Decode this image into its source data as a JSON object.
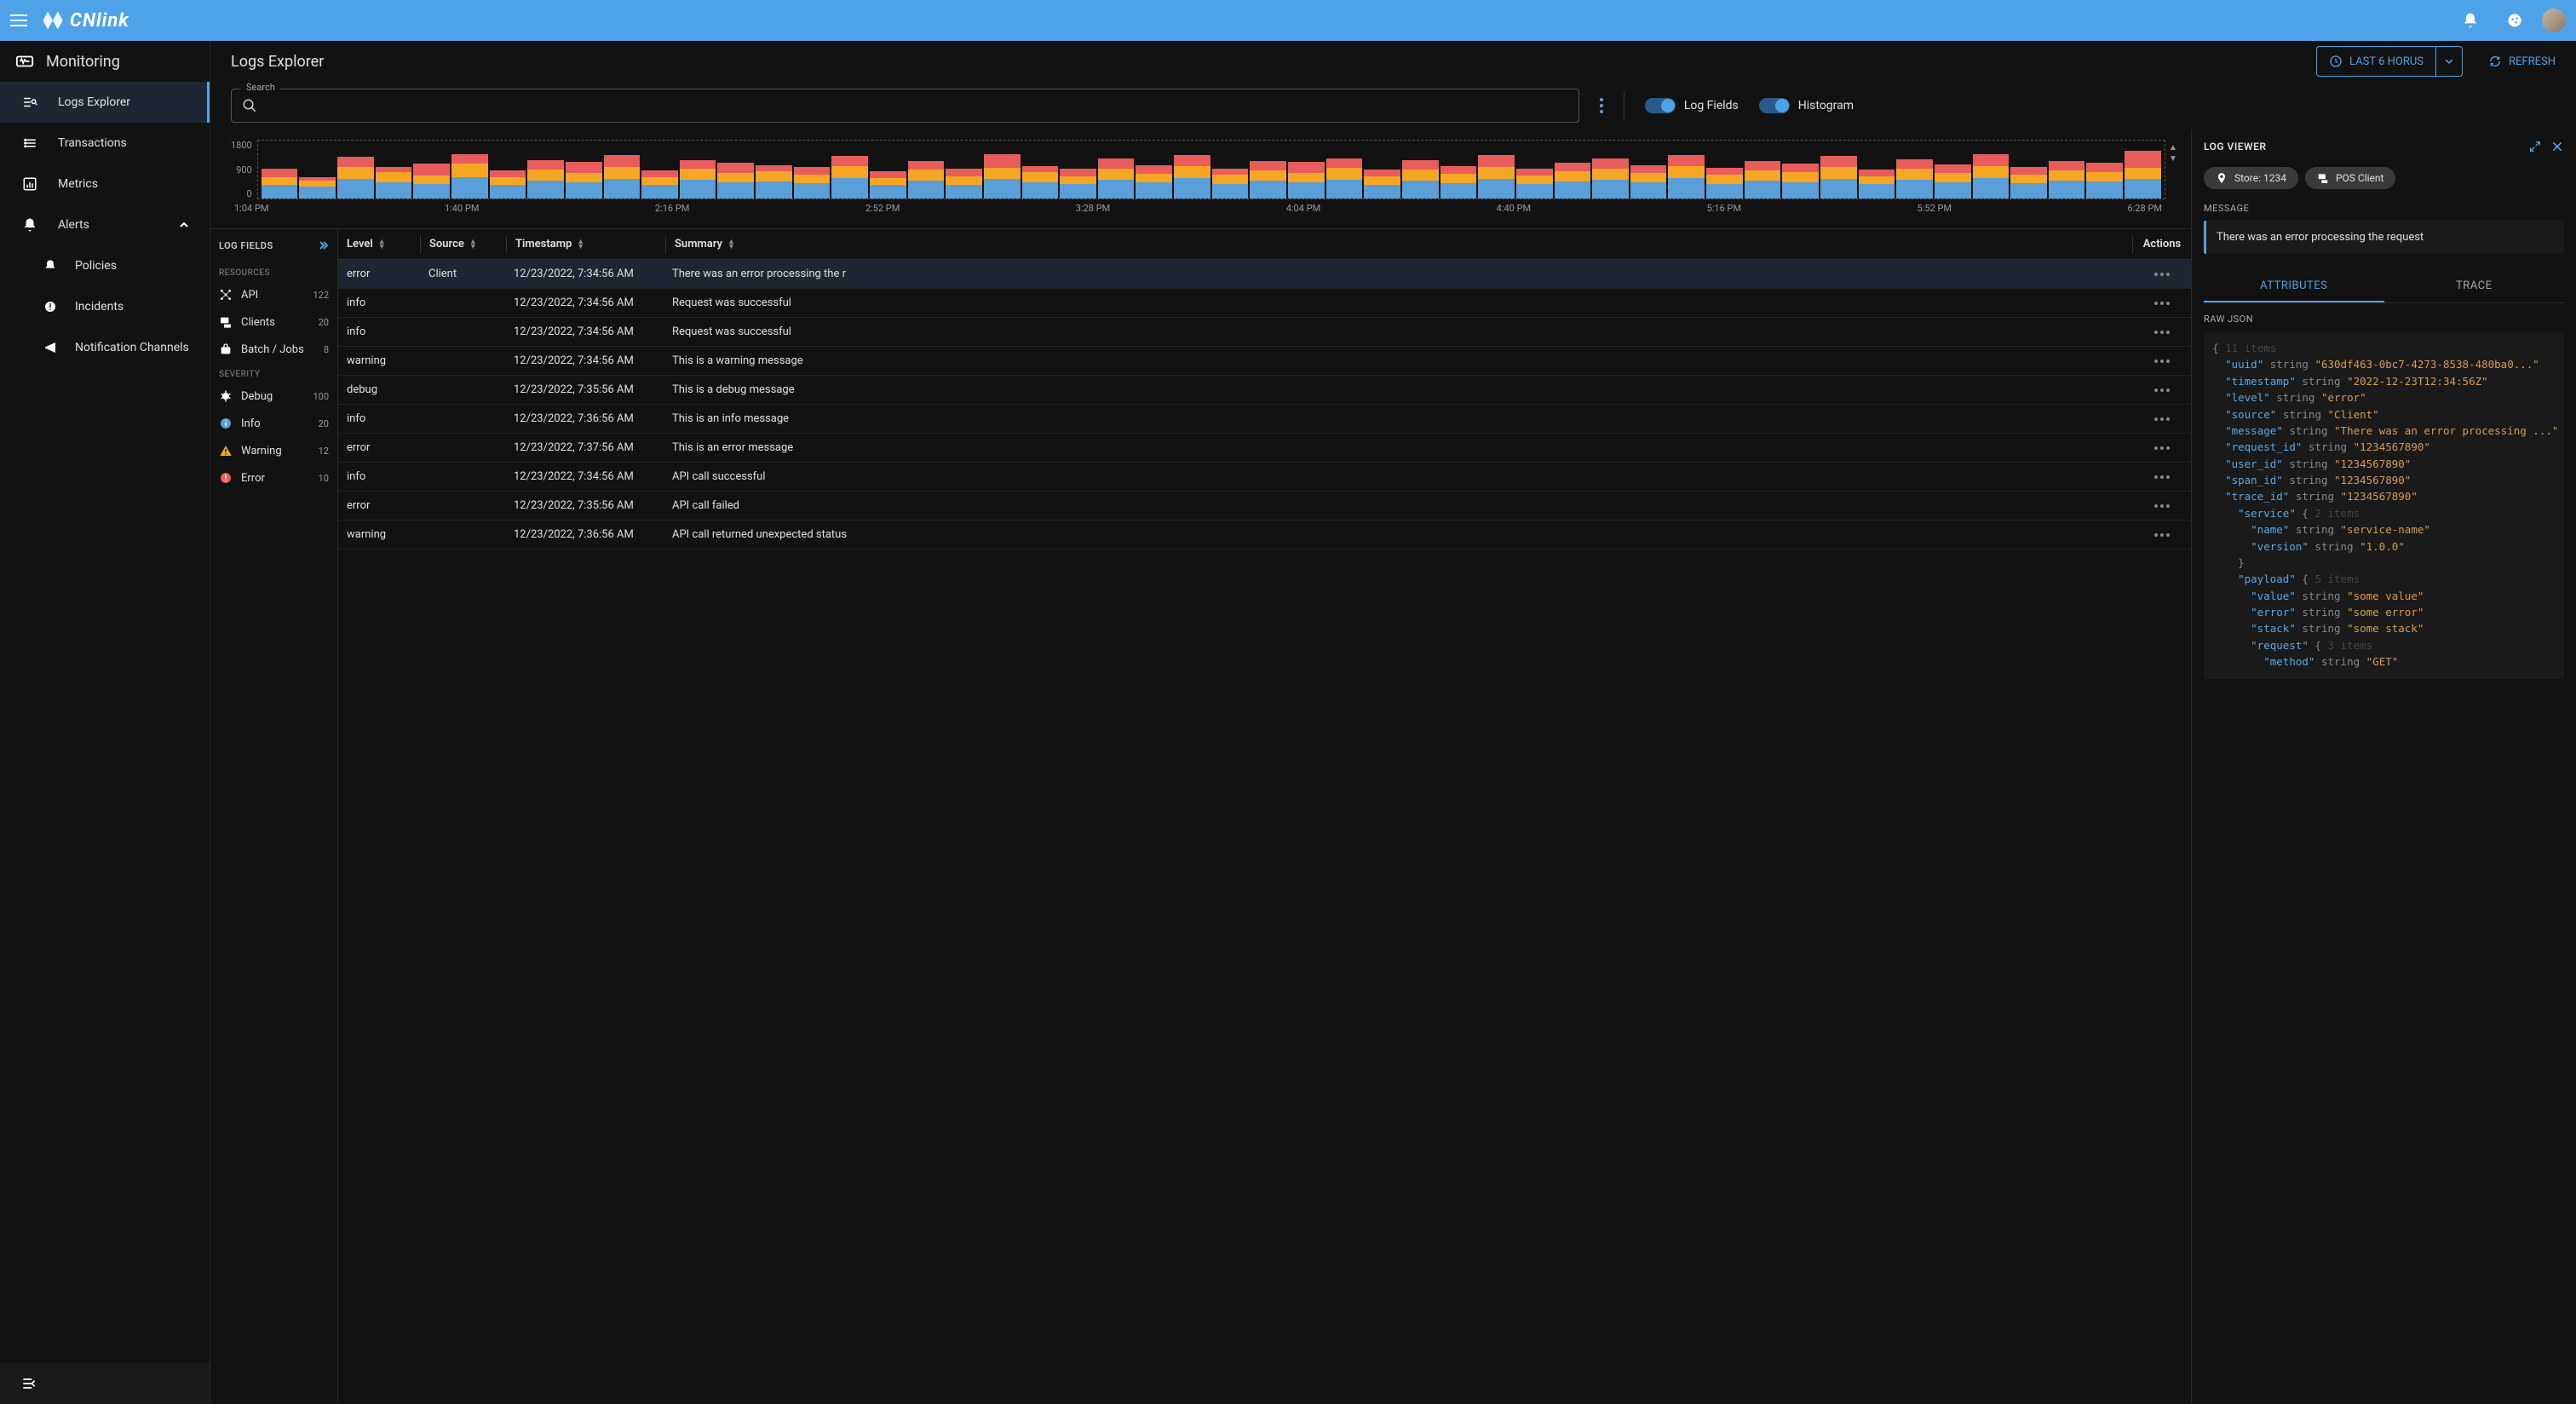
{
  "topbar": {
    "brand": "CNlink"
  },
  "sidebar": {
    "header": "Monitoring",
    "items": [
      {
        "label": "Logs Explorer",
        "active": true
      },
      {
        "label": "Transactions"
      },
      {
        "label": "Metrics"
      },
      {
        "label": "Alerts",
        "expanded": true,
        "children": [
          {
            "label": "Policies"
          },
          {
            "label": "Incidents"
          },
          {
            "label": "Notification Channels"
          }
        ]
      }
    ]
  },
  "header": {
    "title": "Logs Explorer",
    "range_label": "LAST 6 HORUS",
    "refresh_label": "REFRESH"
  },
  "controls": {
    "search_legend": "Search",
    "toggle_fields": "Log Fields",
    "toggle_histogram": "Histogram"
  },
  "chart_data": {
    "type": "bar",
    "ylim": [
      0,
      1800
    ],
    "yticks": [
      0,
      900,
      1800
    ],
    "xticks": [
      "1:04 PM",
      "1:40 PM",
      "2:16 PM",
      "2:52 PM",
      "3:28 PM",
      "4:04 PM",
      "4:40 PM",
      "5:16 PM",
      "5:52 PM",
      "6:28 PM"
    ],
    "series_names": [
      "info",
      "warning",
      "error"
    ],
    "colors": {
      "info": "#5a9fd8",
      "warning": "#f5a623",
      "error": "#e85c5c"
    },
    "bars": [
      {
        "info": 400,
        "warning": 250,
        "error": 250
      },
      {
        "info": 350,
        "warning": 180,
        "error": 120
      },
      {
        "info": 600,
        "warning": 350,
        "error": 300
      },
      {
        "info": 500,
        "warning": 300,
        "error": 150
      },
      {
        "info": 450,
        "warning": 250,
        "error": 350
      },
      {
        "info": 650,
        "warning": 400,
        "error": 300
      },
      {
        "info": 400,
        "warning": 250,
        "error": 200
      },
      {
        "info": 550,
        "warning": 320,
        "error": 280
      },
      {
        "info": 500,
        "warning": 280,
        "error": 320
      },
      {
        "info": 600,
        "warning": 350,
        "error": 350
      },
      {
        "info": 420,
        "warning": 220,
        "error": 200
      },
      {
        "info": 560,
        "warning": 340,
        "error": 260
      },
      {
        "info": 480,
        "warning": 280,
        "error": 320
      },
      {
        "info": 520,
        "warning": 310,
        "error": 180
      },
      {
        "info": 460,
        "warning": 260,
        "error": 240
      },
      {
        "info": 620,
        "warning": 360,
        "error": 300
      },
      {
        "info": 400,
        "warning": 230,
        "error": 200
      },
      {
        "info": 540,
        "warning": 330,
        "error": 260
      },
      {
        "info": 420,
        "warning": 250,
        "error": 220
      },
      {
        "info": 580,
        "warning": 350,
        "error": 420
      },
      {
        "info": 500,
        "warning": 300,
        "error": 180
      },
      {
        "info": 430,
        "warning": 240,
        "error": 220
      },
      {
        "info": 560,
        "warning": 340,
        "error": 300
      },
      {
        "info": 480,
        "warning": 270,
        "error": 260
      },
      {
        "info": 610,
        "warning": 360,
        "error": 330
      },
      {
        "info": 450,
        "warning": 260,
        "error": 200
      },
      {
        "info": 530,
        "warning": 320,
        "error": 280
      },
      {
        "info": 490,
        "warning": 280,
        "error": 340
      },
      {
        "info": 570,
        "warning": 350,
        "error": 300
      },
      {
        "info": 420,
        "warning": 240,
        "error": 210
      },
      {
        "info": 550,
        "warning": 330,
        "error": 270
      },
      {
        "info": 470,
        "warning": 270,
        "error": 230
      },
      {
        "info": 600,
        "warning": 360,
        "error": 350
      },
      {
        "info": 440,
        "warning": 250,
        "error": 200
      },
      {
        "info": 520,
        "warning": 310,
        "error": 260
      },
      {
        "info": 560,
        "warning": 340,
        "error": 300
      },
      {
        "info": 480,
        "warning": 280,
        "error": 240
      },
      {
        "info": 610,
        "warning": 370,
        "error": 320
      },
      {
        "info": 450,
        "warning": 260,
        "error": 210
      },
      {
        "info": 540,
        "warning": 320,
        "error": 280
      },
      {
        "info": 500,
        "warning": 290,
        "error": 260
      },
      {
        "info": 590,
        "warning": 350,
        "error": 340
      },
      {
        "info": 430,
        "warning": 240,
        "error": 200
      },
      {
        "info": 560,
        "warning": 340,
        "error": 290
      },
      {
        "info": 490,
        "warning": 280,
        "error": 250
      },
      {
        "info": 620,
        "warning": 370,
        "error": 360
      },
      {
        "info": 460,
        "warning": 260,
        "error": 220
      },
      {
        "info": 540,
        "warning": 320,
        "error": 280
      },
      {
        "info": 510,
        "warning": 300,
        "error": 260
      },
      {
        "info": 580,
        "warning": 350,
        "error": 500
      }
    ]
  },
  "fields_panel": {
    "title": "LOG FIELDS",
    "sections": [
      {
        "title": "RESOURCES",
        "items": [
          {
            "label": "API",
            "count": "122"
          },
          {
            "label": "Clients",
            "count": "20"
          },
          {
            "label": "Batch / Jobs",
            "count": "8"
          }
        ]
      },
      {
        "title": "SEVERITY",
        "items": [
          {
            "label": "Debug",
            "count": "100"
          },
          {
            "label": "Info",
            "count": "20"
          },
          {
            "label": "Warning",
            "count": "12"
          },
          {
            "label": "Error",
            "count": "10"
          }
        ]
      }
    ]
  },
  "table": {
    "columns": [
      "Level",
      "Source",
      "Timestamp",
      "Summary",
      "Actions"
    ],
    "rows": [
      {
        "level": "error",
        "source": "Client",
        "timestamp": "12/23/2022, 7:34:56 AM",
        "summary": "There was an error processing the r",
        "selected": true
      },
      {
        "level": "info",
        "source": "",
        "timestamp": "12/23/2022, 7:34:56 AM",
        "summary": "Request was successful"
      },
      {
        "level": "info",
        "source": "",
        "timestamp": "12/23/2022, 7:34:56 AM",
        "summary": "Request was successful"
      },
      {
        "level": "warning",
        "source": "",
        "timestamp": "12/23/2022, 7:34:56 AM",
        "summary": "This is a warning message"
      },
      {
        "level": "debug",
        "source": "",
        "timestamp": "12/23/2022, 7:35:56 AM",
        "summary": "This is a debug message"
      },
      {
        "level": "info",
        "source": "",
        "timestamp": "12/23/2022, 7:36:56 AM",
        "summary": "This is an info message"
      },
      {
        "level": "error",
        "source": "",
        "timestamp": "12/23/2022, 7:37:56 AM",
        "summary": "This is an error message"
      },
      {
        "level": "info",
        "source": "",
        "timestamp": "12/23/2022, 7:34:56 AM",
        "summary": "API call successful"
      },
      {
        "level": "error",
        "source": "",
        "timestamp": "12/23/2022, 7:35:56 AM",
        "summary": "API call failed"
      },
      {
        "level": "warning",
        "source": "",
        "timestamp": "12/23/2022, 7:36:56 AM",
        "summary": "API call returned unexpected status"
      }
    ]
  },
  "viewer": {
    "title": "LOG VIEWER",
    "chips": [
      {
        "label": "Store: 1234",
        "icon": "pin"
      },
      {
        "label": "POS Client",
        "icon": "client"
      }
    ],
    "message_label": "MESSAGE",
    "message": "There was an error processing the request",
    "tabs": [
      "ATTRIBUTES",
      "TRACE"
    ],
    "raw_label": "RAW JSON",
    "json_top_count": "11 items",
    "json": [
      {
        "indent": 0,
        "key": "uuid",
        "type": "string",
        "value": "\"630df463-0bc7-4273-8538-480ba0...\""
      },
      {
        "indent": 0,
        "key": "timestamp",
        "type": "string",
        "value": "\"2022-12-23T12:34:56Z\""
      },
      {
        "indent": 0,
        "key": "level",
        "type": "string",
        "value": "\"error\""
      },
      {
        "indent": 0,
        "key": "source",
        "type": "string",
        "value": "\"Client\""
      },
      {
        "indent": 0,
        "key": "message",
        "type": "string",
        "value": "\"There was an error processing ...\""
      },
      {
        "indent": 0,
        "key": "request_id",
        "type": "string",
        "value": "\"1234567890\""
      },
      {
        "indent": 0,
        "key": "user_id",
        "type": "string",
        "value": "\"1234567890\""
      },
      {
        "indent": 0,
        "key": "span_id",
        "type": "string",
        "value": "\"1234567890\""
      },
      {
        "indent": 0,
        "key": "trace_id",
        "type": "string",
        "value": "\"1234567890\""
      },
      {
        "indent": 1,
        "key": "service",
        "type": "object",
        "value": "2 items",
        "open": true
      },
      {
        "indent": 2,
        "key": "name",
        "type": "string",
        "value": "\"service-name\""
      },
      {
        "indent": 2,
        "key": "version",
        "type": "string",
        "value": "\"1.0.0\""
      },
      {
        "indent": 1,
        "close": true
      },
      {
        "indent": 1,
        "key": "payload",
        "type": "object",
        "value": "5 items",
        "open": true
      },
      {
        "indent": 2,
        "key": "value",
        "type": "string",
        "value": "\"some value\""
      },
      {
        "indent": 2,
        "key": "error",
        "type": "string",
        "value": "\"some error\""
      },
      {
        "indent": 2,
        "key": "stack",
        "type": "string",
        "value": "\"some stack\""
      },
      {
        "indent": 2,
        "key": "request",
        "type": "object",
        "value": "3 items",
        "open": true
      },
      {
        "indent": 3,
        "key": "method",
        "type": "string",
        "value": "\"GET\""
      }
    ]
  }
}
